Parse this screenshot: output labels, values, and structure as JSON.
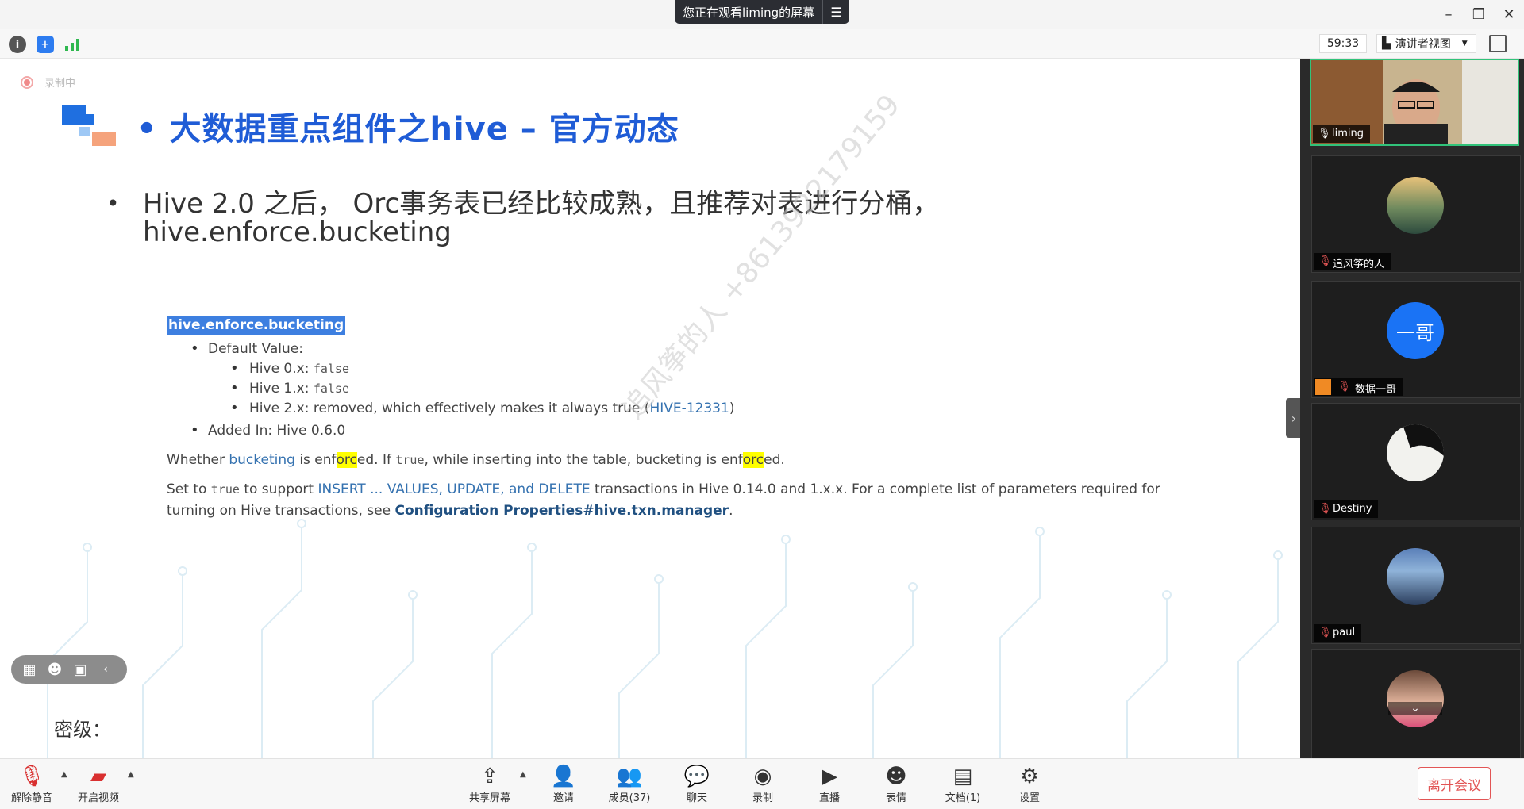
{
  "banner": {
    "text": "您正在观看liming的屏幕",
    "menu_icon": "menu-icon"
  },
  "toolbar": {
    "timer": "59:33",
    "view_label": "演讲者视图"
  },
  "slide": {
    "recording": "录制中",
    "title": "• 大数据重点组件之hive – 官方动态",
    "bullet": "•",
    "main_text": "Hive 2.0 之后， Orc事务表已经比较成熟，且推荐对表进行分桶，hive.enforce.bucketing",
    "doc": {
      "heading": "hive.enforce.bucketing",
      "default_label": "Default Value:",
      "v0_prefix": "Hive 0.x: ",
      "v0_value": "false",
      "v1_prefix": "Hive 1.x: ",
      "v1_value": "false",
      "v2_text": "Hive 2.x: removed, which effectively makes it always true (",
      "v2_link": "HIVE-12331",
      "v2_close": ")",
      "added": "Added In: Hive 0.6.0",
      "p1_a": "Whether ",
      "p1_link": "bucketing",
      "p1_b": " is enf",
      "p1_hl1": "orc",
      "p1_c": "ed. If ",
      "p1_code": "true",
      "p1_d": ", while inserting into the table, bucketing is enf",
      "p1_hl2": "orc",
      "p1_e": "ed.",
      "p2_a": "Set to ",
      "p2_code": "true",
      "p2_b": " to support ",
      "p2_link": "INSERT ... VALUES, UPDATE, and DELETE",
      "p2_c": " transactions in Hive 0.14.0 and 1.x.x. For a complete list of parameters required for turning on Hive transactions, see ",
      "p2_bold": "Configuration Properties#hive.txn.manager",
      "p2_d": "."
    },
    "watermark": "追风筝的人  +8613922179159",
    "footer": "密级："
  },
  "participants": [
    {
      "name": "liming",
      "mic": "on"
    },
    {
      "name": "追风筝的人",
      "mic": "muted"
    },
    {
      "name": "数据一哥",
      "mic": "muted",
      "avatar_text": "一哥"
    },
    {
      "name": "Destiny",
      "mic": "muted"
    },
    {
      "name": "paul",
      "mic": "muted"
    },
    {
      "name": "",
      "mic": "muted"
    }
  ],
  "bottom": {
    "mute": "解除静音",
    "video": "开启视频",
    "share": "共享屏幕",
    "invite": "邀请",
    "members": "成员(37)",
    "chat": "聊天",
    "record": "录制",
    "live": "直播",
    "emoji": "表情",
    "docs": "文档(1)",
    "settings": "设置",
    "leave": "离开会议"
  },
  "colors": {
    "title_blue": "#1f5cd6",
    "active_border": "#31c37a",
    "leave_red": "#e25555"
  }
}
